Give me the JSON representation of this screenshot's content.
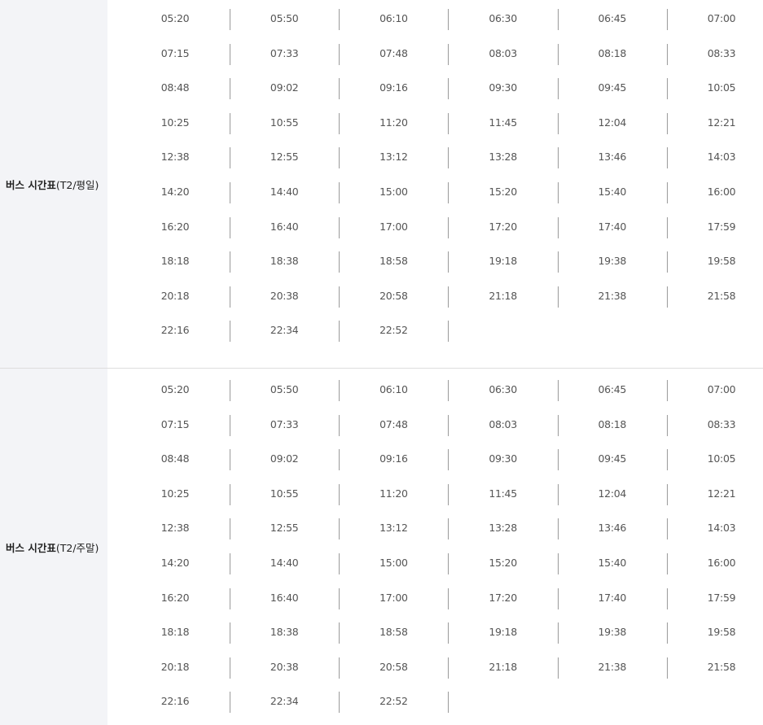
{
  "sections": [
    {
      "label_bold": "버스 시간표",
      "label_rest": "(T2/평일)",
      "rows": [
        [
          "05:20",
          "05:50",
          "06:10",
          "06:30",
          "06:45",
          "07:00"
        ],
        [
          "07:15",
          "07:33",
          "07:48",
          "08:03",
          "08:18",
          "08:33"
        ],
        [
          "08:48",
          "09:02",
          "09:16",
          "09:30",
          "09:45",
          "10:05"
        ],
        [
          "10:25",
          "10:55",
          "11:20",
          "11:45",
          "12:04",
          "12:21"
        ],
        [
          "12:38",
          "12:55",
          "13:12",
          "13:28",
          "13:46",
          "14:03"
        ],
        [
          "14:20",
          "14:40",
          "15:00",
          "15:20",
          "15:40",
          "16:00"
        ],
        [
          "16:20",
          "16:40",
          "17:00",
          "17:20",
          "17:40",
          "17:59"
        ],
        [
          "18:18",
          "18:38",
          "18:58",
          "19:18",
          "19:38",
          "19:58"
        ],
        [
          "20:18",
          "20:38",
          "20:58",
          "21:18",
          "21:38",
          "21:58"
        ],
        [
          "22:16",
          "22:34",
          "22:52"
        ]
      ]
    },
    {
      "label_bold": "버스 시간표",
      "label_rest": "(T2/주말)",
      "rows": [
        [
          "05:20",
          "05:50",
          "06:10",
          "06:30",
          "06:45",
          "07:00"
        ],
        [
          "07:15",
          "07:33",
          "07:48",
          "08:03",
          "08:18",
          "08:33"
        ],
        [
          "08:48",
          "09:02",
          "09:16",
          "09:30",
          "09:45",
          "10:05"
        ],
        [
          "10:25",
          "10:55",
          "11:20",
          "11:45",
          "12:04",
          "12:21"
        ],
        [
          "12:38",
          "12:55",
          "13:12",
          "13:28",
          "13:46",
          "14:03"
        ],
        [
          "14:20",
          "14:40",
          "15:00",
          "15:20",
          "15:40",
          "16:00"
        ],
        [
          "16:20",
          "16:40",
          "17:00",
          "17:20",
          "17:40",
          "17:59"
        ],
        [
          "18:18",
          "18:38",
          "18:58",
          "19:18",
          "19:38",
          "19:58"
        ],
        [
          "20:18",
          "20:38",
          "20:58",
          "21:18",
          "21:38",
          "21:58"
        ],
        [
          "22:16",
          "22:34",
          "22:52"
        ]
      ]
    }
  ]
}
